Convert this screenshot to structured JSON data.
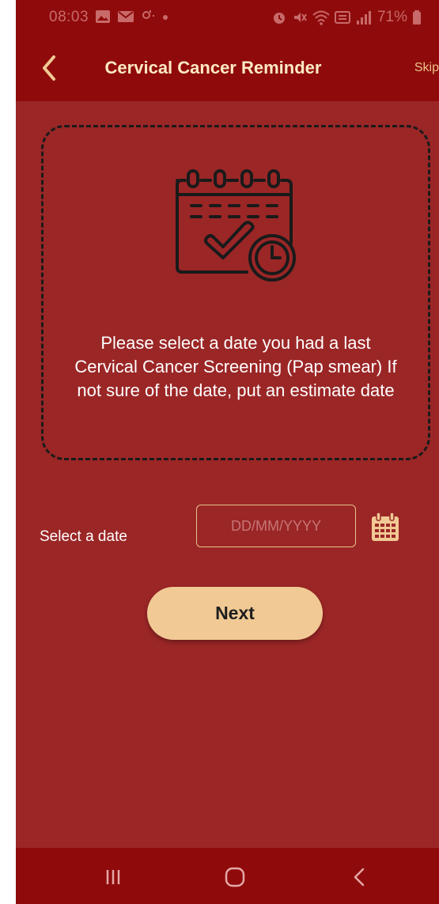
{
  "status_bar": {
    "time": "08:03",
    "battery": "71%"
  },
  "app_bar": {
    "title": "Cervical Cancer Reminder",
    "skip_label": "Skip"
  },
  "card": {
    "icon": "calendar-check-clock-icon",
    "message": "Please select a date you had a last Cervical Cancer Screening (Pap smear) If not sure of the date, put an estimate date"
  },
  "date_field": {
    "label": "Select a date",
    "placeholder": "DD/MM/YYYY",
    "value": ""
  },
  "next_button": {
    "label": "Next"
  },
  "colors": {
    "background": "#9b2626",
    "bar": "#8f0b0b",
    "accent": "#f1c994",
    "title": "#fde9c4"
  }
}
